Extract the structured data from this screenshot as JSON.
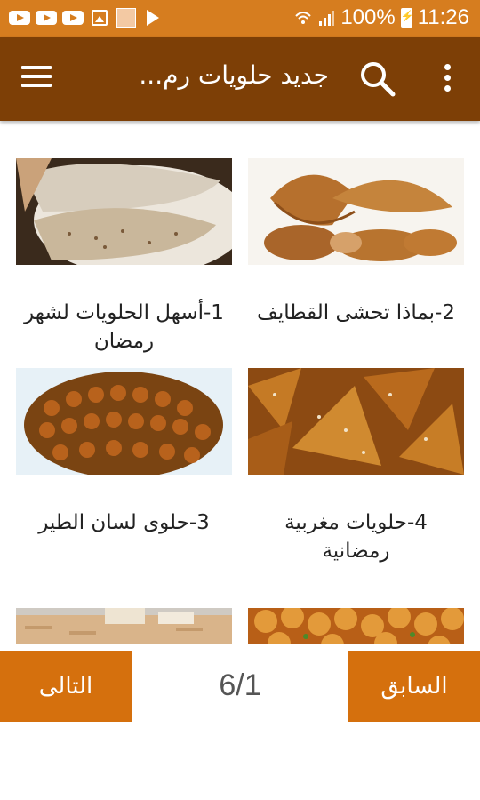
{
  "status_bar": {
    "battery": "100%",
    "time": "11:26",
    "left_icons": [
      "youtube-icon",
      "youtube-icon",
      "youtube-icon",
      "image-icon",
      "avatar-icon",
      "play-store-icon"
    ],
    "right_icons": [
      "wifi-icon",
      "signal-icon",
      "battery-charging-icon"
    ]
  },
  "app_bar": {
    "title": "جديد حلويات رم...",
    "icons": [
      "menu-icon",
      "search-icon",
      "overflow-menu-icon"
    ]
  },
  "items": [
    {
      "caption": "2-بماذا تحشى القطايف",
      "image": "stuffed-qatayef-photo"
    },
    {
      "caption": "1-أسهل الحلويات لشهر رمضان",
      "image": "qatayef-pancakes-photo"
    },
    {
      "caption": "4-حلويات مغربية رمضانية",
      "image": "moroccan-sesame-pastries-photo"
    },
    {
      "caption": "3-حلوى لسان الطير",
      "image": "lisan-al-tayr-pastries-photo"
    },
    {
      "caption": "",
      "image": "fried-dough-balls-photo"
    },
    {
      "caption": "",
      "image": "tray-cake-photo"
    }
  ],
  "pager": {
    "prev_label": "السابق",
    "next_label": "التالى",
    "page_indicator": "6/1"
  },
  "colors": {
    "status_bar": "#d67d1f",
    "app_bar": "#7d3f06",
    "button": "#d5700d"
  }
}
